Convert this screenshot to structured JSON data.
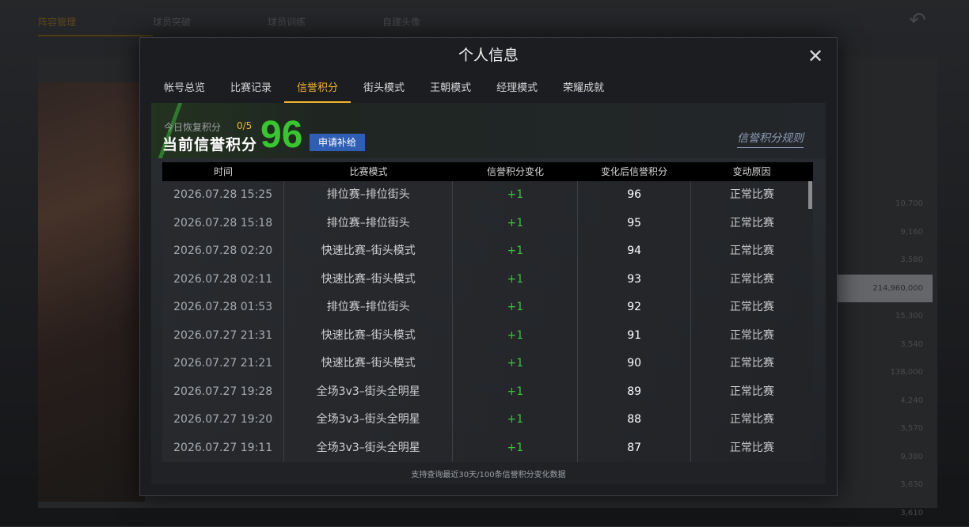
{
  "background": {
    "top_tabs": [
      "阵容管理",
      "球员突破",
      "球员训练",
      "自建头像"
    ],
    "right_values": [
      "10,700",
      "9,160",
      "3,580",
      "214,960,000",
      "15,300",
      "3,540",
      "138,000",
      "4,240",
      "3,570",
      "9,380",
      "3,630",
      "3,610"
    ]
  },
  "modal": {
    "title": "个人信息",
    "close_icon": "close-icon",
    "tabs": [
      "帐号总览",
      "比赛记录",
      "信誉积分",
      "街头模式",
      "王朝模式",
      "经理模式",
      "荣耀成就"
    ],
    "active_tab": "信誉积分"
  },
  "credit": {
    "recover_label": "今日恢复积分",
    "recover_count": "0/5",
    "current_label": "当前信誉积分",
    "score": "96",
    "apply_button": "申请补给",
    "rules_link": "信誉积分规则"
  },
  "table": {
    "headers": [
      "时间",
      "比赛模式",
      "信誉积分变化",
      "变化后信誉积分",
      "变动原因"
    ],
    "rows": [
      [
        "2026.07.28  15:25",
        "排位赛–排位街头",
        "+1",
        "96",
        "正常比赛"
      ],
      [
        "2026.07.28  15:18",
        "排位赛–排位街头",
        "+1",
        "95",
        "正常比赛"
      ],
      [
        "2026.07.28  02:20",
        "快速比赛–街头模式",
        "+1",
        "94",
        "正常比赛"
      ],
      [
        "2026.07.28  02:11",
        "快速比赛–街头模式",
        "+1",
        "93",
        "正常比赛"
      ],
      [
        "2026.07.28  01:53",
        "排位赛–排位街头",
        "+1",
        "92",
        "正常比赛"
      ],
      [
        "2026.07.27  21:31",
        "快速比赛–街头模式",
        "+1",
        "91",
        "正常比赛"
      ],
      [
        "2026.07.27  21:21",
        "快速比赛–街头模式",
        "+1",
        "90",
        "正常比赛"
      ],
      [
        "2026.07.27  19:28",
        "全场3v3–街头全明星",
        "+1",
        "89",
        "正常比赛"
      ],
      [
        "2026.07.27  19:20",
        "全场3v3–街头全明星",
        "+1",
        "88",
        "正常比赛"
      ],
      [
        "2026.07.27  19:11",
        "全场3v3–街头全明星",
        "+1",
        "87",
        "正常比赛"
      ]
    ],
    "footer_note": "支持查询最近30天/100条信誉积分变化数据"
  },
  "colors": {
    "accent": "#f2b431",
    "score_green": "#38c62f",
    "button_blue": "#2f5fb4"
  }
}
